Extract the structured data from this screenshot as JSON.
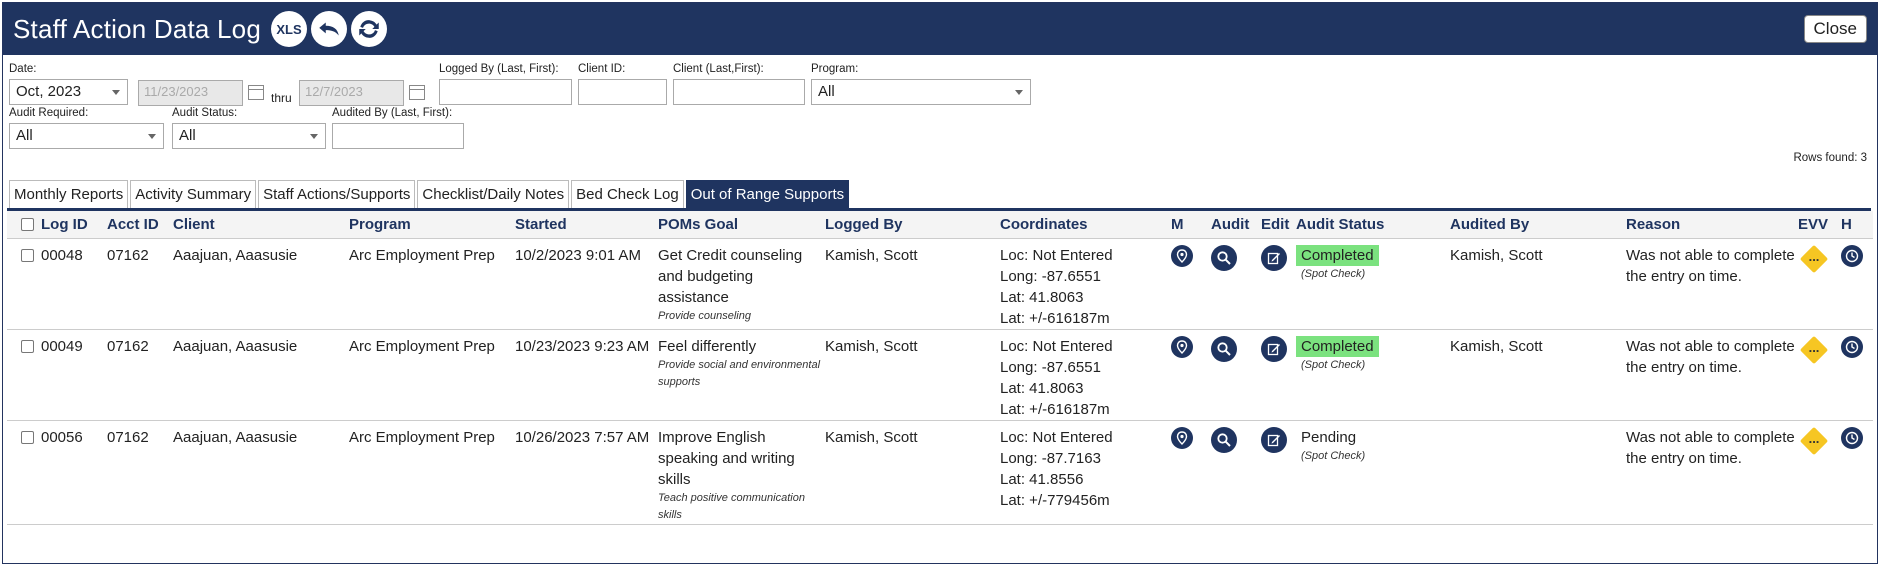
{
  "window": {
    "title": "Staff Action Data Log",
    "close_label": "Close",
    "xls_label": "XLS"
  },
  "filters": {
    "date_label": "Date:",
    "date_value": "Oct, 2023",
    "from_value": "11/23/2023",
    "thru_label": "thru",
    "to_value": "12/7/2023",
    "logged_by_label": "Logged By (Last, First):",
    "client_id_label": "Client ID:",
    "client_name_label": "Client (Last,First):",
    "program_label": "Program:",
    "program_value": "All",
    "audit_required_label": "Audit Required:",
    "audit_required_value": "All",
    "audit_status_label": "Audit Status:",
    "audit_status_value": "All",
    "audited_by_label": "Audited By (Last, First):",
    "rows_found": "Rows found: 3"
  },
  "tabs": [
    {
      "label": "Monthly Reports"
    },
    {
      "label": "Activity Summary"
    },
    {
      "label": "Staff Actions/Supports"
    },
    {
      "label": "Checklist/Daily Notes"
    },
    {
      "label": "Bed Check Log"
    },
    {
      "label": "Out of Range Supports"
    }
  ],
  "columns": {
    "log_id": "Log ID",
    "acct_id": "Acct ID",
    "client": "Client",
    "program": "Program",
    "started": "Started",
    "poms_goal": "POMs Goal",
    "logged_by": "Logged By",
    "coordinates": "Coordinates",
    "m": "M",
    "audit": "Audit",
    "edit": "Edit",
    "audit_status": "Audit Status",
    "audited_by": "Audited By",
    "reason": "Reason",
    "evv": "EVV",
    "h": "H"
  },
  "rows": [
    {
      "log_id": "00048",
      "acct_id": "07162",
      "client": "Aaajuan, Aaasusie",
      "program": "Arc Employment Prep",
      "started": "10/2/2023 9:01 AM",
      "goal": "Get Credit counseling and budgeting assistance",
      "goal_sub": "Provide counseling",
      "logged_by": "Kamish, Scott",
      "loc": "Loc: Not Entered",
      "long": "Long: -87.6551",
      "lat": "Lat: 41.8063",
      "acc": "Lat: +/-616187m",
      "status": "Completed",
      "status_sub": "(Spot Check)",
      "audited_by": "Kamish, Scott",
      "reason": "Was not able to complete the entry on time.",
      "evv": "..."
    },
    {
      "log_id": "00049",
      "acct_id": "07162",
      "client": "Aaajuan, Aaasusie",
      "program": "Arc Employment Prep",
      "started": "10/23/2023 9:23 AM",
      "goal": "Feel differently",
      "goal_sub": "Provide social and environmental supports",
      "logged_by": "Kamish, Scott",
      "loc": "Loc: Not Entered",
      "long": "Long: -87.6551",
      "lat": "Lat: 41.8063",
      "acc": "Lat: +/-616187m",
      "status": "Completed",
      "status_sub": "(Spot Check)",
      "audited_by": "Kamish, Scott",
      "reason": "Was not able to complete the entry on time.",
      "evv": "..."
    },
    {
      "log_id": "00056",
      "acct_id": "07162",
      "client": "Aaajuan, Aaasusie",
      "program": "Arc Employment Prep",
      "started": "10/26/2023 7:57 AM",
      "goal": "Improve English speaking and writing skills",
      "goal_sub": "Teach positive communication skills",
      "logged_by": "Kamish, Scott",
      "loc": "Loc: Not Entered",
      "long": "Long: -87.7163",
      "lat": "Lat: 41.8556",
      "acc": "Lat: +/-779456m",
      "status": "Pending",
      "status_sub": "(Spot Check)",
      "audited_by": "",
      "reason": "Was not able to complete the entry on time.",
      "evv": "..."
    }
  ]
}
